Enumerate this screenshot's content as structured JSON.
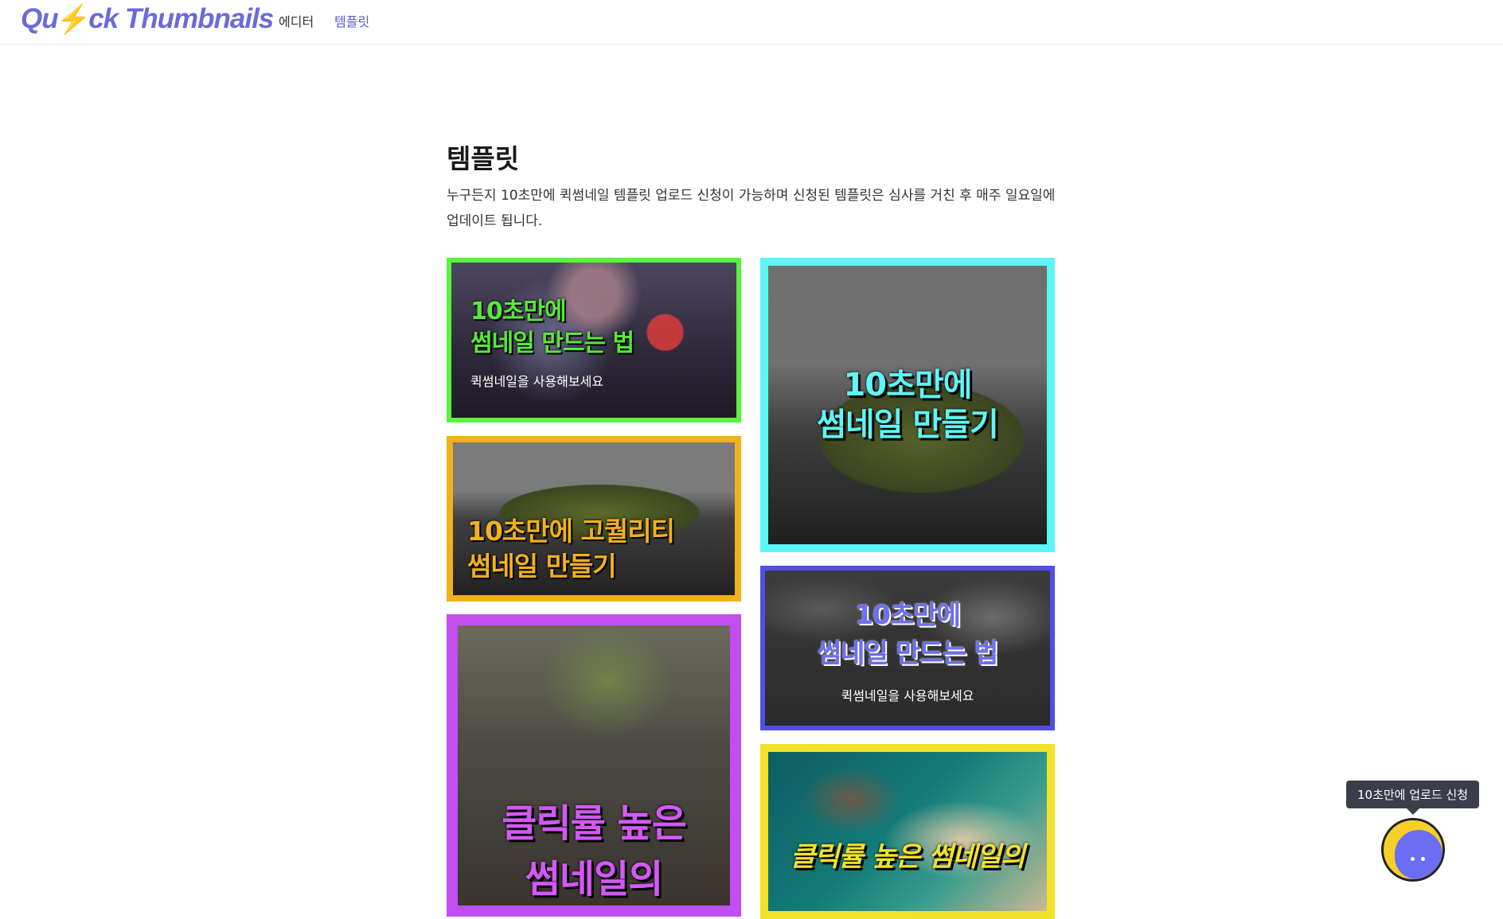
{
  "app": {
    "logo_prefix": "Qu",
    "logo_bolt": "⚡",
    "logo_suffix": "ck Thumbnails"
  },
  "nav": {
    "items": [
      {
        "label": "에디터"
      },
      {
        "label": "템플릿"
      }
    ],
    "active": "템플릿"
  },
  "page": {
    "title": "템플릿",
    "description": "누구든지 10초만에 퀵썸네일 템플릿 업로드 신청이 가능하며 신청된 템플릿은 심사를 거친 후 매주 일요일에 업데이트 됩니다."
  },
  "templates": [
    {
      "line1": "10초만에",
      "line2": "썸네일 만드는 법",
      "sub": "퀵썸네일을 사용해보세요",
      "frame_color": "#5af23c",
      "text_color": "#58e83a"
    },
    {
      "line1": "10초만에",
      "line2": "썸네일 만들기",
      "sub": "",
      "frame_color": "#5df6f6",
      "text_color": "#5df6f6"
    },
    {
      "line1": "10초만에 고퀄리티",
      "line2": "썸네일 만들기",
      "sub": "",
      "frame_color": "#f0b21c",
      "text_color": "#f3b11b"
    },
    {
      "line1": "10초만에",
      "line2": "썸네일 만드는 법",
      "sub": "퀵썸네일을 사용해보세요",
      "frame_color": "#4f4fe8",
      "text_color": "#5b5df0"
    },
    {
      "line1": "클릭률 높은",
      "line2": "썸네일의",
      "sub": "",
      "frame_color": "#c24ef2",
      "text_color": "#d458f6"
    },
    {
      "line1": "클릭률 높은 썸네일의",
      "line2": "",
      "sub": "",
      "frame_color": "#f2e22a",
      "text_color": "#f3e22a"
    }
  ],
  "floating": {
    "tooltip": "10초만에 업로드 신청",
    "icon": "mascot-icon"
  }
}
